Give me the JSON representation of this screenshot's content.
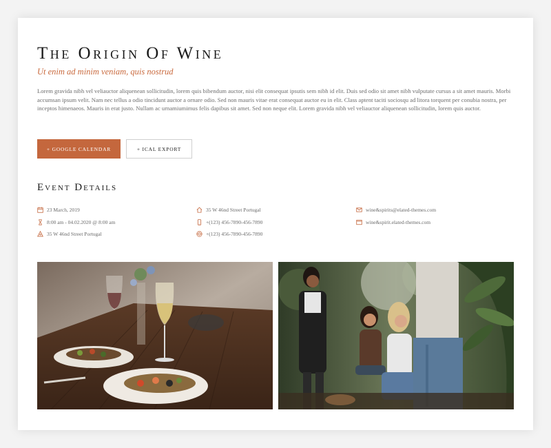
{
  "event": {
    "title": "The Origin Of Wine",
    "subtitle": "Ut enim ad minim veniam, quis nostrud",
    "description": "Lorem gravida nibh vel veliauctor aliquenean sollicitudin, lorem quis bibendum auctor, nisi elit consequat ipsutis sem nibh id elit. Duis sed odio sit amet nibh vulputate cursus a sit amet mauris. Morbi accumsan ipsum velit. Nam nec tellus a odio tincidunt auctor a ornare odio. Sed non mauris vitae erat consequat auctor eu in elit. Class aptent taciti sociosqu ad litora torquent per conubia nostra, per inceptos himenaeos. Mauris in erat justo. Nullam ac urnamiumimus felis dapibus sit amet. Sed non neque elit. Lorem gravida nibh vel veliauctor aliquenean sollicitudin, lorem quis auctor."
  },
  "buttons": {
    "google_calendar": "+ Google Calendar",
    "ical_export": "+ iCal Export"
  },
  "details": {
    "heading": "Event Details",
    "column1": [
      {
        "icon": "calendar-icon",
        "text": "23 March, 2019"
      },
      {
        "icon": "hourglass-icon",
        "text": "8:00 am - 04.02.2020 @ 8:00 am"
      },
      {
        "icon": "location-icon",
        "text": "35 W 46nd Street Portugal"
      }
    ],
    "column2": [
      {
        "icon": "home-icon",
        "text": "35 W 46nd Street Portugal"
      },
      {
        "icon": "phone-icon",
        "text": "+(123) 456-7890-456-7890"
      },
      {
        "icon": "support-icon",
        "text": "+(123) 456-7890-456-7890"
      }
    ],
    "column3": [
      {
        "icon": "mail-icon",
        "text": "wine&spirits@elated-themes.com"
      },
      {
        "icon": "browser-icon",
        "text": "wine&spirit.elated-themes.com"
      }
    ]
  },
  "images": [
    {
      "name": "wine-table-photo"
    },
    {
      "name": "friends-outdoor-photo"
    }
  ],
  "colors": {
    "accent": "#c4673d",
    "subtitle": "#c96a3e",
    "heading": "#1a1a1a",
    "body_text": "#6d6d6d"
  }
}
